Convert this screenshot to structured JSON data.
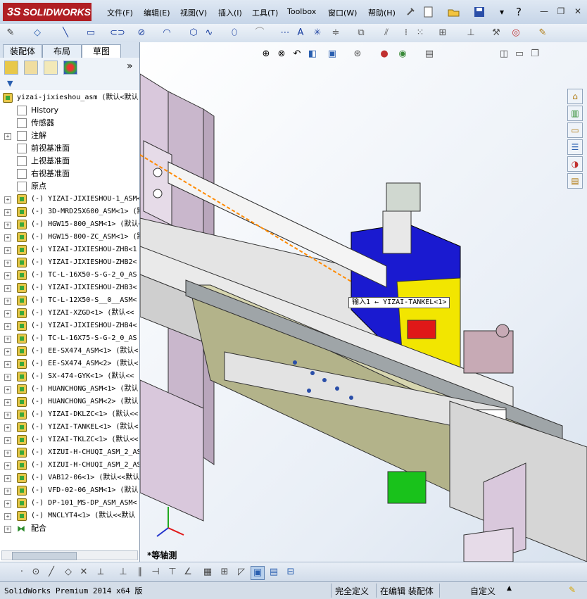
{
  "app": {
    "logo_prefix": "3S",
    "logo_text": "SOLIDWORKS",
    "menu": [
      "文件(F)",
      "编辑(E)",
      "视图(V)",
      "插入(I)",
      "工具(T)",
      "Toolbox",
      "窗口(W)",
      "帮助(H)"
    ],
    "help_label": "?"
  },
  "left_panel": {
    "tabs": [
      "装配体",
      "布局",
      "草图"
    ],
    "active_tab": "草图",
    "expand_label": "»",
    "tree_root": "yizai-jixieshou_asm  (默认<默认",
    "fixed_items": [
      {
        "label": "History",
        "icon": "history-icon"
      },
      {
        "label": "传感器",
        "icon": "sensor-icon"
      },
      {
        "label": "注解",
        "icon": "annotation-icon"
      },
      {
        "label": "前视基准面",
        "icon": "plane-icon"
      },
      {
        "label": "上视基准面",
        "icon": "plane-icon"
      },
      {
        "label": "右视基准面",
        "icon": "plane-icon"
      },
      {
        "label": "原点",
        "icon": "origin-icon"
      }
    ],
    "components": [
      "(-) YIZAI-JIXIESHOU-1_ASM<",
      "(-) 3D-MRD25X600_ASM<1> (默",
      "(-) HGW15-800_ASM<1> (默认<",
      "(-) HGW15-800-ZC_ASM<1> (默",
      "(-) YIZAI-JIXIESHOU-ZHB<1",
      "(-) YIZAI-JIXIESHOU-ZHB2<",
      "(-) TC-L-16X50-S-G-2_0_AS",
      "(-) YIZAI-JIXIESHOU-ZHB3<",
      "(-) TC-L-12X50-S__0__ASM<",
      "(-) YIZAI-XZGD<1> (默认<<",
      "(-) YIZAI-JIXIESHOU-ZHB4<",
      "(-) TC-L-16X75-S-G-2_0_AS",
      "(-) EE-SX474_ASM<1> (默认<",
      "(-) EE-SX474_ASM<2> (默认<",
      "(-) SX-474-GYK<1> (默认<<",
      "(-) HUANCHONG_ASM<1> (默认",
      "(-) HUANCHONG_ASM<2> (默认",
      "(-) YIZAI-DKLZC<1> (默认<<",
      "(-) YIZAI-TANKEL<1> (默认<",
      "(-) YIZAI-TKLZC<1> (默认<<",
      "(-) XIZUI-H-CHUQI_ASM_2_AS",
      "(-) XIZUI-H-CHUQI_ASM_2_AS",
      "(-) VAB12-06<1> (默认<<默认",
      "(-) VFD-02-06_ASM<1> (默认",
      "(-) DP-101_MS-DP_ASM_ASM<",
      "(-) MNCLYT4<1> (默认<<默认"
    ],
    "mates_label": "配合"
  },
  "viewport": {
    "tooltip": "输入1 ← YIZAI-TANKEL<1>",
    "view_name": "*等轴测"
  },
  "status": {
    "product": "SolidWorks Premium 2014 x64 版",
    "definition": "完全定义",
    "editing": "在编辑 装配体",
    "units": "自定义",
    "units_arrow": "▲"
  },
  "colors": {
    "accent_red": "#b01e23",
    "part_blue": "#1a1ad0",
    "part_yellow": "#f2e600",
    "part_green": "#19c21b",
    "part_red": "#e01818",
    "frame_purple": "#d9c8dc"
  }
}
